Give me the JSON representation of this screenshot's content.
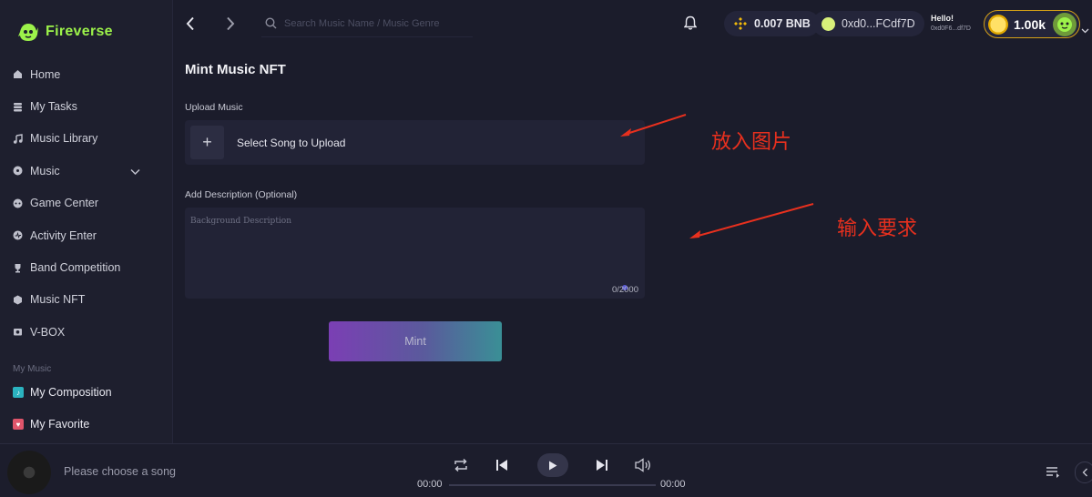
{
  "brand": {
    "name": "Fireverse",
    "accent": "#9cf24a"
  },
  "sidebar": {
    "items": [
      {
        "label": "Home",
        "icon": "home-icon"
      },
      {
        "label": "My Tasks",
        "icon": "tasks-icon"
      },
      {
        "label": "Music Library",
        "icon": "music-note-icon"
      },
      {
        "label": "Music",
        "icon": "music-disc-icon",
        "expandable": true
      },
      {
        "label": "Game Center",
        "icon": "gamepad-icon"
      },
      {
        "label": "Activity Enter",
        "icon": "activity-icon"
      },
      {
        "label": "Band Competition",
        "icon": "trophy-icon"
      },
      {
        "label": "Music NFT",
        "icon": "nft-icon"
      },
      {
        "label": "V-BOX",
        "icon": "box-icon"
      }
    ],
    "section_label": "My Music",
    "my_items": [
      {
        "label": "My Composition",
        "icon": "composition-icon",
        "color": "#2bb3c0"
      },
      {
        "label": "My Favorite",
        "icon": "favorite-icon",
        "color": "#e0556b"
      }
    ]
  },
  "header": {
    "search_placeholder": "Search Music Name / Music Genre",
    "bnb_balance": "0.007 BNB",
    "wallet_address": "0xd0...FCdf7D",
    "greeting": "Hello!",
    "short_address": "0xd0F6...df7D",
    "coins": "1.00k"
  },
  "main": {
    "title": "Mint Music NFT",
    "upload_label": "Upload Music",
    "upload_button": "Select Song to Upload",
    "description_label": "Add Description (Optional)",
    "description_placeholder": "Background Description",
    "counter": "0/2000",
    "mint_button": "Mint"
  },
  "annotations": {
    "upload_note": "放入图片",
    "description_note": "输入要求",
    "color": "#e8301e"
  },
  "player": {
    "status": "Please choose a song",
    "time_current": "00:00",
    "time_total": "00:00"
  }
}
